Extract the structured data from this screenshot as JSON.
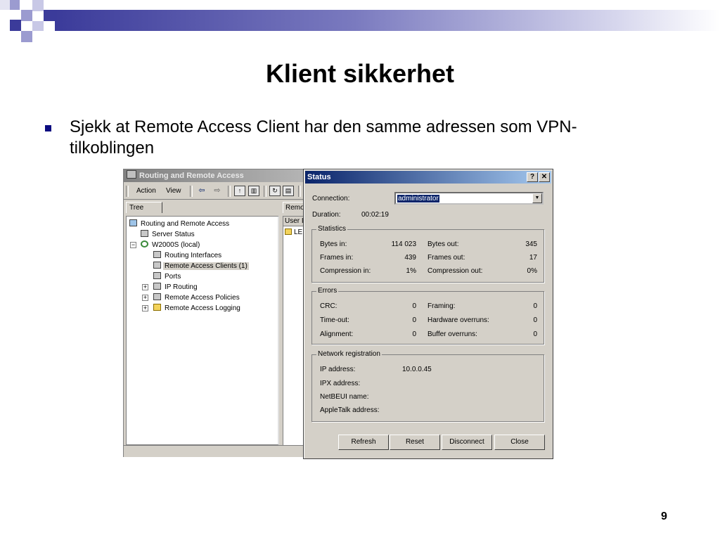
{
  "slide": {
    "title": "Klient sikkerhet",
    "bullet": "Sjekk at Remote Access Client har den samme adressen som VPN-tilkoblingen",
    "page_number": "9"
  },
  "mmc": {
    "title": "Routing and Remote Access",
    "menu": [
      "Action",
      "View"
    ],
    "toolbar_icons": [
      "back-arrow-icon",
      "forward-arrow-icon",
      "up-folder-icon",
      "show-hide-tree-icon",
      "refresh-icon",
      "export-list-icon"
    ],
    "tree_tab": "Tree",
    "right_tab": "Remo",
    "right_column": "User I",
    "right_row": "LEI",
    "tree": [
      {
        "label": "Routing and Remote Access",
        "icon": "computer-icon"
      },
      {
        "label": "Server Status",
        "icon": "server-icon"
      },
      {
        "label": "W2000S (local)",
        "icon": "server-gear-icon"
      },
      {
        "label": "Routing Interfaces",
        "icon": "network-icon"
      },
      {
        "label": "Remote Access Clients (1)",
        "icon": "network-icon"
      },
      {
        "label": "Ports",
        "icon": "network-icon"
      },
      {
        "label": "IP Routing",
        "icon": "network-icon"
      },
      {
        "label": "Remote Access Policies",
        "icon": "policy-icon"
      },
      {
        "label": "Remote Access Logging",
        "icon": "folder-icon"
      }
    ]
  },
  "status_dialog": {
    "title": "Status",
    "help_label": "?",
    "close_label": "✕",
    "connection_label": "Connection:",
    "connection_value": "administrator",
    "duration_label": "Duration:",
    "duration_value": "00:02:19",
    "statistics": {
      "title": "Statistics",
      "bytes_in_label": "Bytes in:",
      "bytes_in": "114 023",
      "bytes_out_label": "Bytes out:",
      "bytes_out": "345",
      "frames_in_label": "Frames in:",
      "frames_in": "439",
      "frames_out_label": "Frames out:",
      "frames_out": "17",
      "compression_in_label": "Compression in:",
      "compression_in": "1%",
      "compression_out_label": "Compression out:",
      "compression_out": "0%"
    },
    "errors": {
      "title": "Errors",
      "crc_label": "CRC:",
      "crc": "0",
      "framing_label": "Framing:",
      "framing": "0",
      "timeout_label": "Time-out:",
      "timeout": "0",
      "hardware_overruns_label": "Hardware overruns:",
      "hardware_overruns": "0",
      "alignment_label": "Alignment:",
      "alignment": "0",
      "buffer_overruns_label": "Buffer overruns:",
      "buffer_overruns": "0"
    },
    "network": {
      "title": "Network registration",
      "ip_label": "IP address:",
      "ip": "10.0.0.45",
      "ipx_label": "IPX address:",
      "netbeui_label": "NetBEUI name:",
      "appletalk_label": "AppleTalk address:"
    },
    "buttons": {
      "refresh": "Refresh",
      "reset": "Reset",
      "disconnect": "Disconnect",
      "close": "Close"
    }
  },
  "colors": {
    "bullet": "#0b0b80",
    "title_bar_active": "#0a246a",
    "dialog_face": "#d4d0c8"
  }
}
